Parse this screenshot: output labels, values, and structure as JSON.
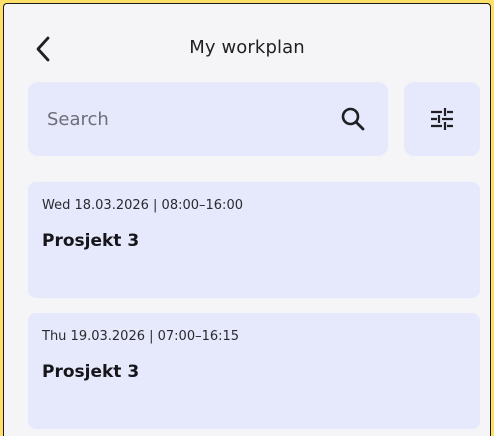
{
  "header": {
    "title": "My workplan",
    "back_icon": "chevron-left-icon"
  },
  "search": {
    "placeholder": "Search",
    "value": "",
    "icon": "search-icon"
  },
  "filter": {
    "icon": "sliders-icon"
  },
  "entries": [
    {
      "day": "Wed",
      "date": "18.03.2026",
      "time": "08:00–16:00",
      "meta": "Wed 18.03.2026  |  08:00–16:00",
      "project": "Prosjekt 3"
    },
    {
      "day": "Thu",
      "date": "19.03.2026",
      "time": "07:00–16:15",
      "meta": "Thu 19.03.2026  |  07:00–16:15",
      "project": "Prosjekt 3"
    }
  ],
  "colors": {
    "background": "#F5F5F7",
    "card": "#E6E8FC",
    "frame": "#FDDF6A",
    "text": "#1f1f24"
  }
}
